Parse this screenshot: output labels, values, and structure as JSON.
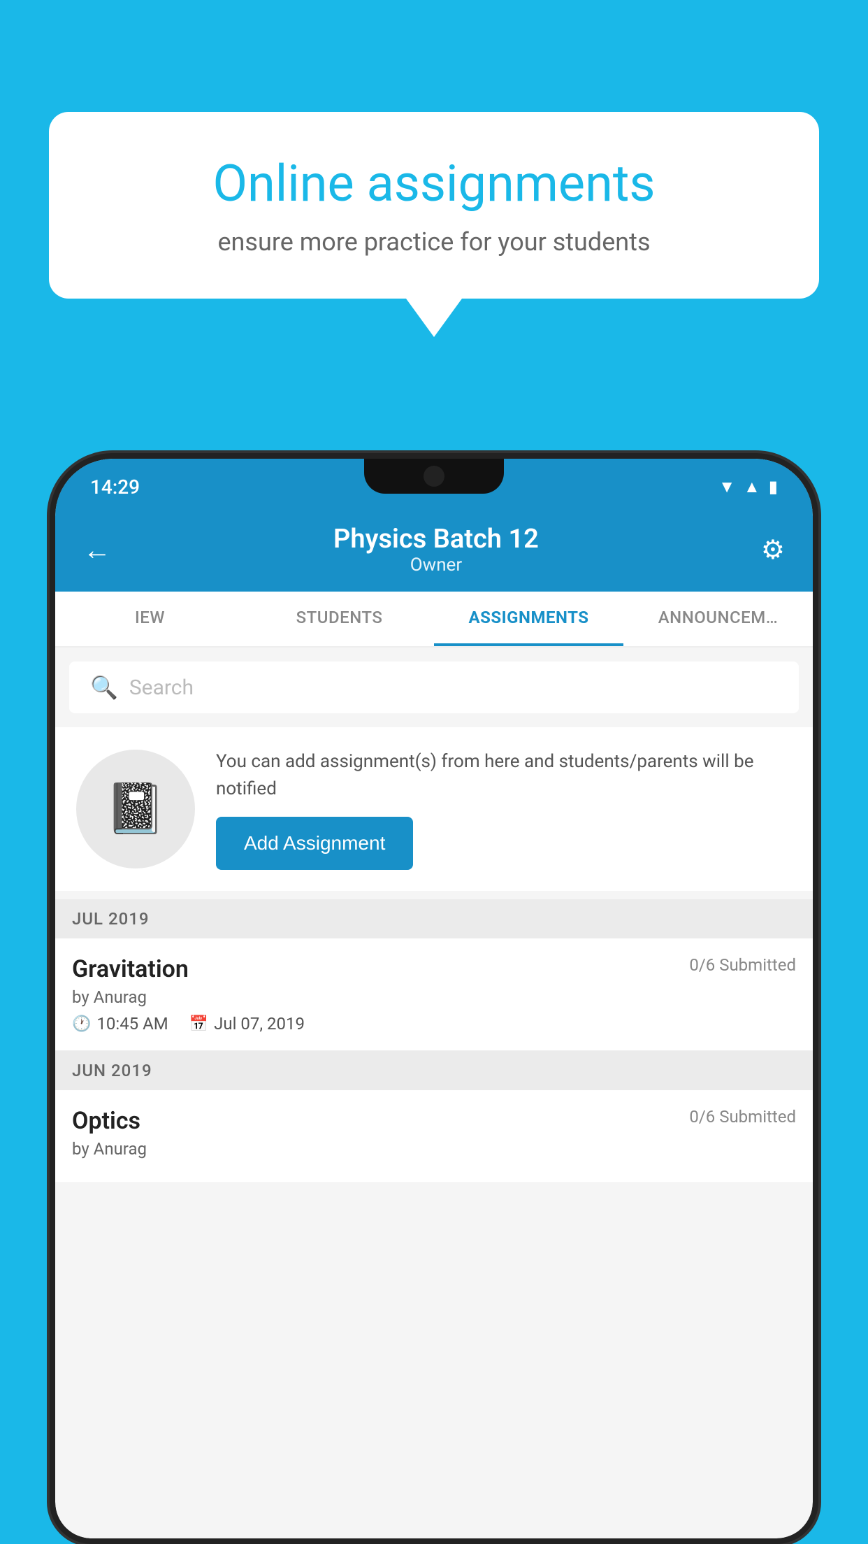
{
  "background_color": "#1ab8e8",
  "speech_bubble": {
    "title": "Online assignments",
    "subtitle": "ensure more practice for your students"
  },
  "status_bar": {
    "time": "14:29",
    "wifi": "▼",
    "signal": "▲",
    "battery": "▮"
  },
  "header": {
    "title": "Physics Batch 12",
    "subtitle": "Owner",
    "back_label": "←",
    "settings_label": "⚙"
  },
  "tabs": [
    {
      "label": "IEW",
      "active": false
    },
    {
      "label": "STUDENTS",
      "active": false
    },
    {
      "label": "ASSIGNMENTS",
      "active": true
    },
    {
      "label": "ANNOUNCEM…",
      "active": false
    }
  ],
  "search": {
    "placeholder": "Search"
  },
  "promo": {
    "text": "You can add assignment(s) from here and students/parents will be notified",
    "button_label": "Add Assignment"
  },
  "sections": [
    {
      "label": "JUL 2019",
      "assignments": [
        {
          "name": "Gravitation",
          "submitted": "0/6 Submitted",
          "by": "by Anurag",
          "time": "10:45 AM",
          "date": "Jul 07, 2019"
        }
      ]
    },
    {
      "label": "JUN 2019",
      "assignments": [
        {
          "name": "Optics",
          "submitted": "0/6 Submitted",
          "by": "by Anurag",
          "time": "",
          "date": ""
        }
      ]
    }
  ]
}
